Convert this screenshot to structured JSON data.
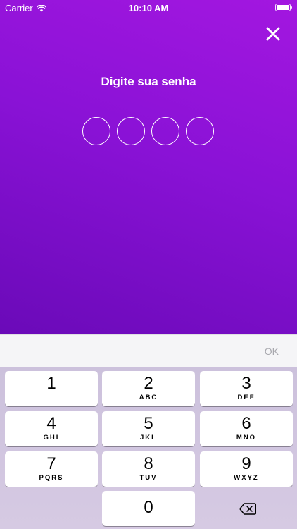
{
  "status_bar": {
    "carrier": "Carrier",
    "time": "10:10 AM"
  },
  "header": {
    "title": "Digite sua senha",
    "close_icon": "close-icon"
  },
  "pin": {
    "length": 4,
    "filled": 0
  },
  "accessory": {
    "ok_label": "OK"
  },
  "keypad": {
    "keys": [
      {
        "num": "1",
        "letters": ""
      },
      {
        "num": "2",
        "letters": "ABC"
      },
      {
        "num": "3",
        "letters": "DEF"
      },
      {
        "num": "4",
        "letters": "GHI"
      },
      {
        "num": "5",
        "letters": "JKL"
      },
      {
        "num": "6",
        "letters": "MNO"
      },
      {
        "num": "7",
        "letters": "PQRS"
      },
      {
        "num": "8",
        "letters": "TUV"
      },
      {
        "num": "9",
        "letters": "WXYZ"
      },
      {
        "num": "0",
        "letters": ""
      }
    ],
    "delete_icon": "backspace-icon"
  },
  "colors": {
    "gradient_top": "#a317e0",
    "gradient_bottom": "#6a0ab8",
    "keypad_bg": "#ccc1dc"
  }
}
